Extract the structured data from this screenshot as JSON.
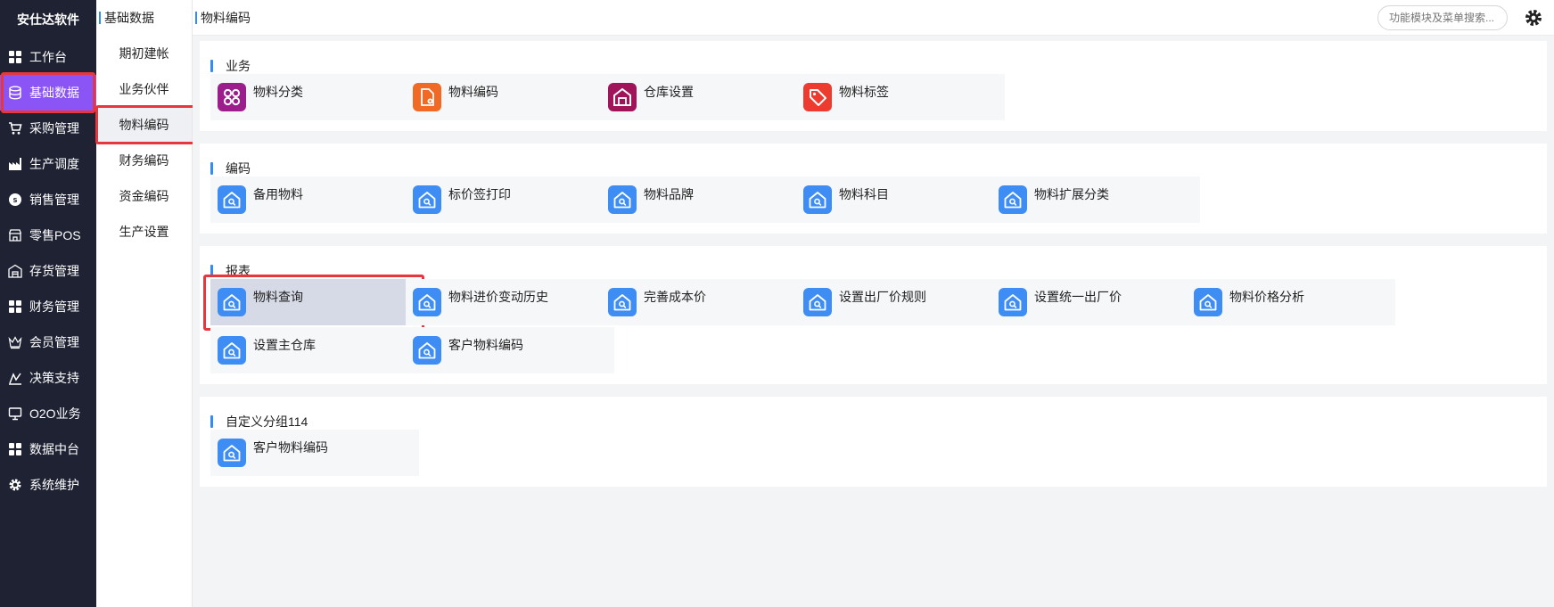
{
  "app": {
    "brand": "安仕达软件"
  },
  "sidebar": {
    "items": [
      {
        "label": "工作台",
        "icon": "grid-icon",
        "active": false
      },
      {
        "label": "基础数据",
        "icon": "database-icon",
        "active": true
      },
      {
        "label": "采购管理",
        "icon": "cart-icon",
        "active": false
      },
      {
        "label": "生产调度",
        "icon": "factory-icon",
        "active": false
      },
      {
        "label": "销售管理",
        "icon": "sales-icon",
        "active": false
      },
      {
        "label": "零售POS",
        "icon": "store-icon",
        "active": false
      },
      {
        "label": "存货管理",
        "icon": "warehouse-icon",
        "active": false
      },
      {
        "label": "财务管理",
        "icon": "grid-icon",
        "active": false
      },
      {
        "label": "会员管理",
        "icon": "crown-icon",
        "active": false
      },
      {
        "label": "决策支持",
        "icon": "chart-icon",
        "active": false
      },
      {
        "label": "O2O业务",
        "icon": "monitor-icon",
        "active": false
      },
      {
        "label": "数据中台",
        "icon": "grid-icon",
        "active": false
      },
      {
        "label": "系统维护",
        "icon": "gear-icon",
        "active": false
      }
    ]
  },
  "submenu": {
    "title": "基础数据",
    "items": [
      {
        "label": "期初建帐",
        "active": false
      },
      {
        "label": "业务伙伴",
        "active": false
      },
      {
        "label": "物料编码",
        "active": true
      },
      {
        "label": "财务编码",
        "active": false
      },
      {
        "label": "资金编码",
        "active": false
      },
      {
        "label": "生产设置",
        "active": false
      }
    ]
  },
  "header": {
    "breadcrumb": "物料编码",
    "search_placeholder": "功能模块及菜单搜索..."
  },
  "sections": [
    {
      "title": "业务",
      "tiles": [
        {
          "label": "物料分类",
          "icon": "category-icon",
          "color": "#9c1d8c"
        },
        {
          "label": "物料编码",
          "icon": "document-gear-icon",
          "color": "#f06a25"
        },
        {
          "label": "仓库设置",
          "icon": "warehouse-icon",
          "color": "#a0145a"
        },
        {
          "label": "物料标签",
          "icon": "tag-icon",
          "color": "#ee3b2f"
        }
      ]
    },
    {
      "title": "编码",
      "tiles": [
        {
          "label": "备用物料",
          "icon": "home-search-icon",
          "color": "#3d8df5"
        },
        {
          "label": "标价签打印",
          "icon": "home-search-icon",
          "color": "#3d8df5"
        },
        {
          "label": "物料品牌",
          "icon": "home-search-icon",
          "color": "#3d8df5"
        },
        {
          "label": "物料科目",
          "icon": "home-search-icon",
          "color": "#3d8df5"
        },
        {
          "label": "物料扩展分类",
          "icon": "home-search-icon",
          "color": "#3d8df5"
        }
      ]
    },
    {
      "title": "报表",
      "tiles": [
        {
          "label": "物料查询",
          "icon": "home-search-icon",
          "color": "#3d8df5",
          "highlighted": true
        },
        {
          "label": "物料进价变动历史",
          "icon": "home-search-icon",
          "color": "#3d8df5"
        },
        {
          "label": "完善成本价",
          "icon": "home-search-icon",
          "color": "#3d8df5"
        },
        {
          "label": "设置出厂价规则",
          "icon": "home-search-icon",
          "color": "#3d8df5"
        },
        {
          "label": "设置统一出厂价",
          "icon": "home-search-icon",
          "color": "#3d8df5"
        },
        {
          "label": "物料价格分析",
          "icon": "home-search-icon",
          "color": "#3d8df5"
        },
        {
          "label": "设置主仓库",
          "icon": "home-search-icon",
          "color": "#3d8df5"
        },
        {
          "label": "客户物料编码",
          "icon": "home-search-icon",
          "color": "#3d8df5"
        }
      ]
    },
    {
      "title": "自定义分组114",
      "tiles": [
        {
          "label": "客户物料编码",
          "icon": "home-search-icon",
          "color": "#3d8df5"
        }
      ]
    }
  ]
}
